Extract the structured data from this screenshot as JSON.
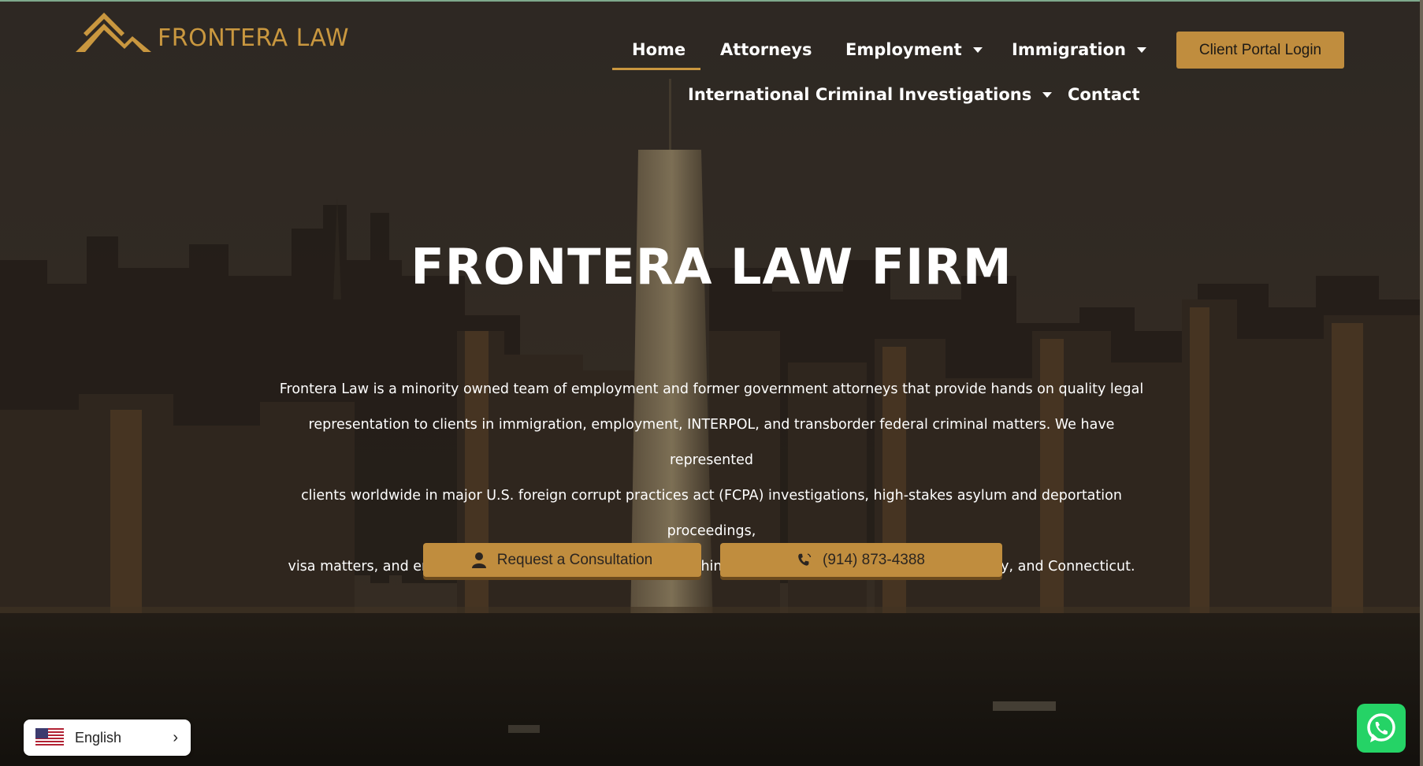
{
  "brand": {
    "name": "FRONTERA LAW",
    "accent": "#c9973f"
  },
  "nav": {
    "home": "Home",
    "attorneys": "Attorneys",
    "employment": "Employment",
    "immigration": "Immigration",
    "international": "International Criminal Investigations",
    "contact": "Contact",
    "portal": "Client Portal Login"
  },
  "hero": {
    "title": "FRONTERA LAW FIRM",
    "lines": [
      "Frontera Law is a minority owned team of employment and former government attorneys that provide hands on quality legal",
      "representation to clients in immigration, employment, INTERPOL, and transborder federal criminal matters. We have represented",
      "clients worldwide in major U.S. foreign corrupt practices act (FCPA) investigations, high-stakes asylum and deportation proceedings,",
      "visa matters, and employment and discrimination cases within the tristate area of New York, New Jersey, and Connecticut."
    ],
    "consult_btn": "Request a Consultation",
    "phone_btn": "(914) 873-4388",
    "consult_icon": "user-icon",
    "phone_icon": "phone-icon"
  },
  "language": {
    "label": "English",
    "flag_icon": "us-flag-icon",
    "chevron_icon": "chevron-right-icon"
  },
  "widgets": {
    "whatsapp_icon": "whatsapp-icon",
    "whatsapp_color": "#25d366"
  }
}
